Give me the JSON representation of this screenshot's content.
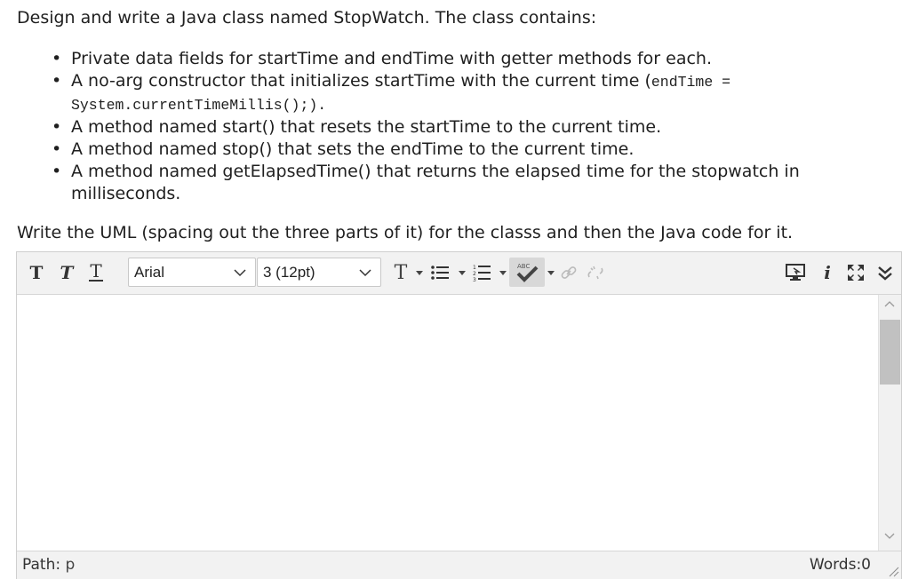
{
  "question": {
    "intro": "Design and write a Java class named StopWatch. The class contains:",
    "bullets": {
      "b1": "Private data fields for startTime and endTime with getter methods for each.",
      "b2_text": "A no-arg constructor that initializes startTime with the current time (",
      "b2_code1": "endTime =",
      "b2_code2": "System.currentTimeMillis();).",
      "b3": "A method named start() that resets the startTime to the current time.",
      "b4": "A method named stop() that sets the endTime to the current time.",
      "b5_line1": "A method named getElapsedTime() that returns the elapsed time for the stopwatch in",
      "b5_line2": "milliseconds."
    },
    "task": "Write the UML (spacing out the three parts of it) for the classs and then the Java code for it."
  },
  "editor": {
    "font_family_value": "Arial",
    "font_size_value": "3 (12pt)",
    "spellcheck_label": "ABC",
    "body_text": "",
    "status": {
      "path_label": "Path:",
      "path_value": "p",
      "words": "Words:0"
    },
    "icons": [
      "bold-icon",
      "italic-icon",
      "underline-icon",
      "text-color-icon",
      "bullet-list-icon",
      "numbered-list-icon",
      "spellcheck-icon",
      "link-icon",
      "unlink-icon",
      "preview-icon",
      "info-icon",
      "fullscreen-icon",
      "collapse-icon"
    ]
  }
}
